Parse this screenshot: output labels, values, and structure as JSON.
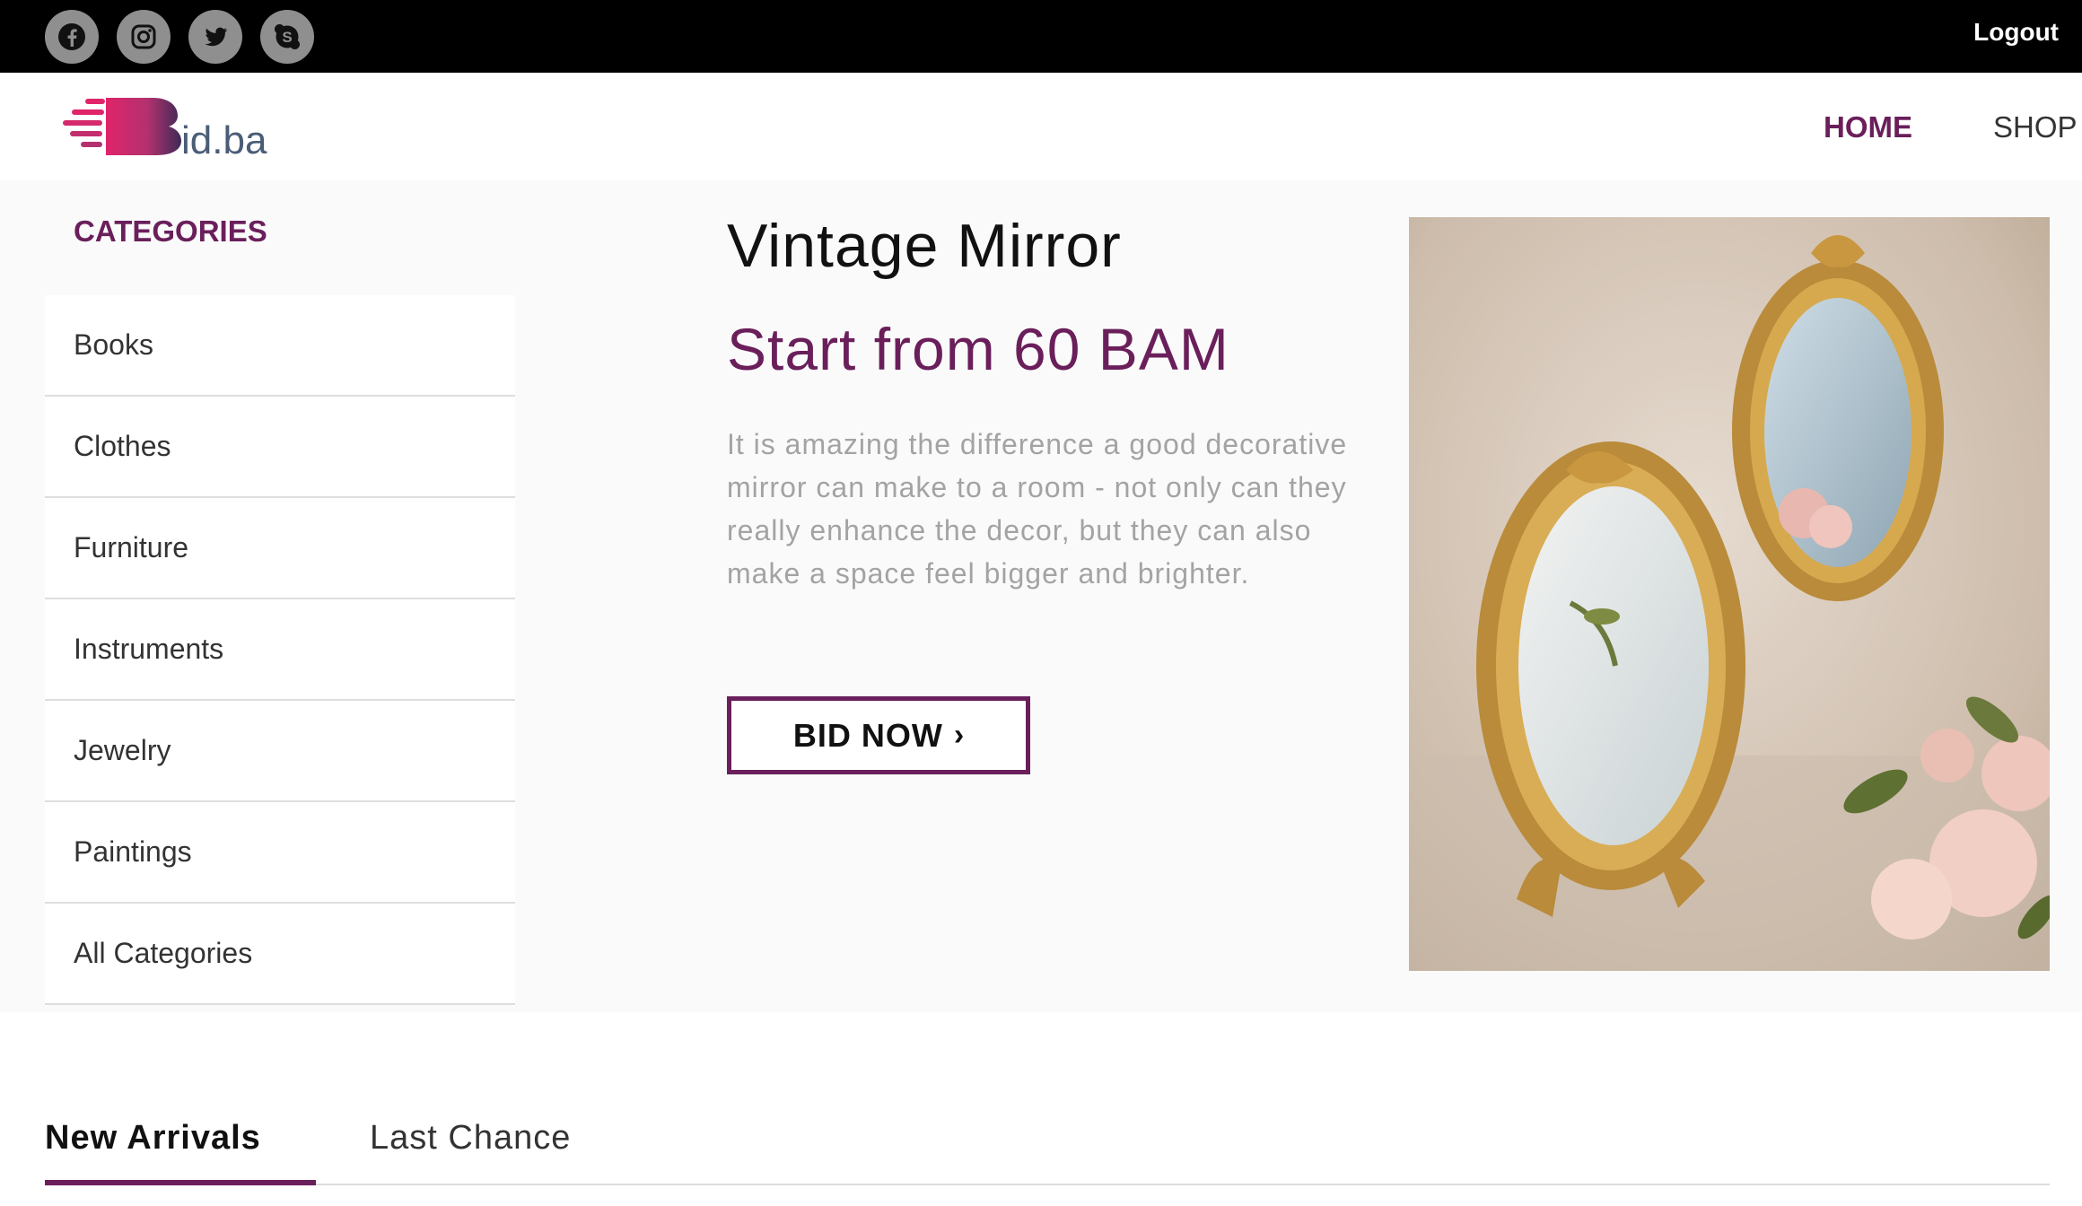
{
  "topbar": {
    "social_icons": [
      "facebook-icon",
      "instagram-icon",
      "twitter-icon",
      "skype-icon"
    ],
    "logout_label": "Logout"
  },
  "header": {
    "logo_text": "id.ba",
    "nav": {
      "home": "HOME",
      "shop": "SHOP"
    }
  },
  "sidebar": {
    "title": "CATEGORIES",
    "items": [
      "Books",
      "Clothes",
      "Furniture",
      "Instruments",
      "Jewelry",
      "Paintings",
      "All Categories"
    ]
  },
  "featured": {
    "title": "Vintage Mirror",
    "price": "Start from 60 BAM",
    "description": "It is amazing the difference a good decorative mirror can make to a room - not only can they really enhance the decor, but they can also make a space feel bigger and brighter.",
    "button_label": "BID NOW",
    "button_icon": "chevron-right-icon"
  },
  "tabs": {
    "new_arrivals": "New Arrivals",
    "last_chance": "Last Chance",
    "active": "New Arrivals"
  },
  "colors": {
    "accent": "#6a1f5b",
    "topbar": "#000000",
    "hero_bg": "#fafafa",
    "social_icon_bg": "#8f8f8f"
  }
}
